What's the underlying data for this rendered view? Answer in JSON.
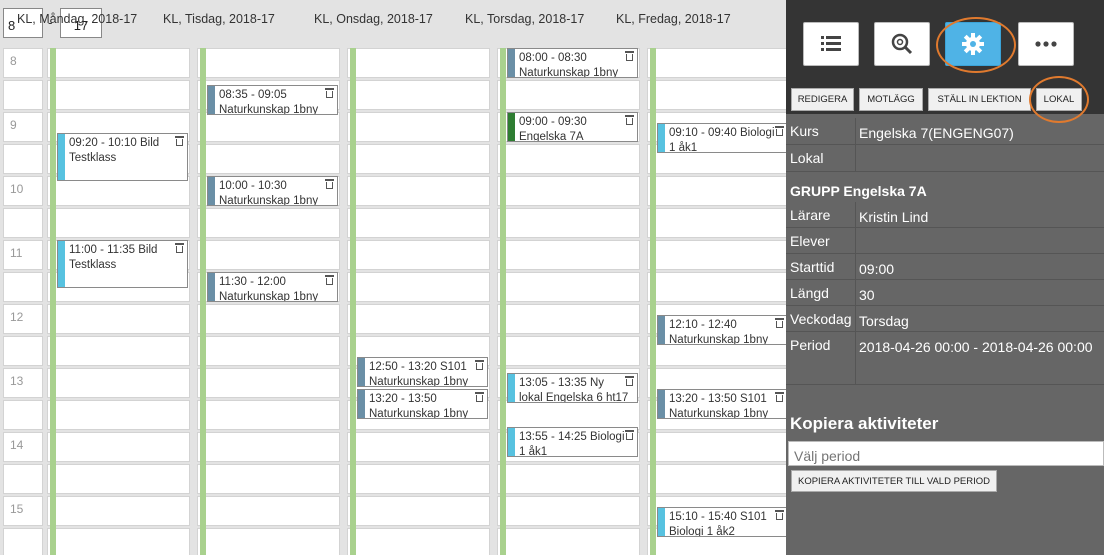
{
  "calendar": {
    "hour_start": "8",
    "hour_end": "17",
    "separator": "-",
    "days": [
      "KL, Måndag, 2018-17",
      "KL, Tisdag, 2018-17",
      "KL, Onsdag, 2018-17",
      "KL, Torsdag, 2018-17",
      "KL, Fredag, 2018-17"
    ],
    "hours": [
      "8",
      "9",
      "10",
      "11",
      "12",
      "13",
      "14",
      "15"
    ],
    "events": [
      {
        "day": 0,
        "start": "09:20",
        "time": "09:20 - 10:10 Bild",
        "name": "Testklass",
        "color": "#57c2e0"
      },
      {
        "day": 0,
        "start": "11:00",
        "time": "11:00 - 11:35 Bild",
        "name": "Testklass",
        "color": "#57c2e0"
      },
      {
        "day": 1,
        "start": "08:35",
        "time": "08:35 - 09:05",
        "name": "Naturkunskap 1bny",
        "color": "#6a8fa6"
      },
      {
        "day": 1,
        "start": "10:00",
        "time": "10:00 - 10:30",
        "name": "Naturkunskap 1bny",
        "color": "#6a8fa6"
      },
      {
        "day": 1,
        "start": "11:30",
        "time": "11:30 - 12:00",
        "name": "Naturkunskap 1bny",
        "color": "#6a8fa6"
      },
      {
        "day": 2,
        "start": "12:50",
        "time": "12:50 - 13:20 S101",
        "name": "Naturkunskap 1bny",
        "color": "#6a8fa6"
      },
      {
        "day": 2,
        "start": "13:20",
        "time": "13:20 - 13:50",
        "name": "Naturkunskap 1bny",
        "color": "#6a8fa6"
      },
      {
        "day": 3,
        "start": "08:00",
        "time": "08:00 - 08:30",
        "name": "Naturkunskap 1bny",
        "color": "#6a8fa6"
      },
      {
        "day": 3,
        "start": "09:00",
        "time": "09:00 - 09:30",
        "name": "Engelska 7A",
        "color": "#2e7d32"
      },
      {
        "day": 3,
        "start": "13:05",
        "time": "13:05 - 13:35 Ny",
        "name": "lokal Engelska 6 ht17",
        "color": "#57c2e0"
      },
      {
        "day": 3,
        "start": "13:55",
        "time": "13:55 - 14:25 Biologi",
        "name": "1 åk1",
        "color": "#57c2e0"
      },
      {
        "day": 4,
        "start": "09:10",
        "time": "09:10 - 09:40 Biologi",
        "name": "1 åk1",
        "color": "#57c2e0"
      },
      {
        "day": 4,
        "start": "12:10",
        "time": "12:10 - 12:40",
        "name": "Naturkunskap 1bny",
        "color": "#6a8fa6"
      },
      {
        "day": 4,
        "start": "13:20",
        "time": "13:20 - 13:50 S101",
        "name": "Naturkunskap 1bny",
        "color": "#6a8fa6"
      },
      {
        "day": 4,
        "start": "15:10",
        "time": "15:10 - 15:40 S101",
        "name": "Biologi 1 åk2",
        "color": "#57c2e0"
      }
    ]
  },
  "panel": {
    "toolbar": [
      {
        "icon": "list-icon"
      },
      {
        "icon": "zoom-icon"
      },
      {
        "icon": "gear-icon",
        "active": true
      },
      {
        "icon": "more-icon"
      }
    ],
    "actions": {
      "edit": "REDIGERA",
      "counter": "MOTLÄGG",
      "cancel": "STÄLL IN LEKTION",
      "room": "LOKAL"
    },
    "details": [
      {
        "label": "Kurs",
        "value": "Engelska 7(ENGENG07)"
      },
      {
        "label": "Lokal",
        "value": ""
      }
    ],
    "group": "GRUPP Engelska 7A",
    "group_details": [
      {
        "label": "Lärare",
        "value": "Kristin Lind"
      },
      {
        "label": "Elever",
        "value": ""
      },
      {
        "label": "Starttid",
        "value": "09:00"
      },
      {
        "label": "Längd",
        "value": "30"
      },
      {
        "label": "Veckodag",
        "value": "Torsdag"
      },
      {
        "label": "Period",
        "value": "2018-04-26 00:00 - 2018-04-26 00:00"
      }
    ],
    "copy": {
      "title": "Kopiera aktiviteter",
      "period_placeholder": "Välj period",
      "button": "KOPIERA AKTIVITETER TILL VALD PERIOD"
    },
    "accent_color": "#4fb3e6",
    "highlight_color": "#e07a2e"
  }
}
